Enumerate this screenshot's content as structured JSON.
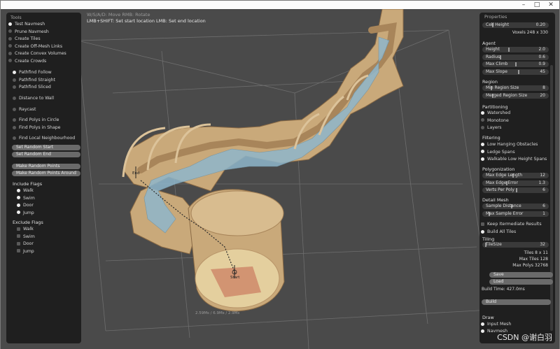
{
  "hud": {
    "help_line1": "W/S/A/D: Move  RMB: Rotate",
    "help_line2": "LMB+SHIFT: Set start location  LMB: Set end location",
    "start_label": "Start",
    "end_label": "End",
    "bottom_stats": "2.59Ms / 6.9Ms / 2.9Ms"
  },
  "tools": {
    "title": "Tools",
    "tool_options": [
      {
        "label": "Test Navmesh",
        "on": true
      },
      {
        "label": "Prune Navmesh",
        "on": false
      },
      {
        "label": "Create Tiles",
        "on": false
      },
      {
        "label": "Create Off-Mesh Links",
        "on": false
      },
      {
        "label": "Create Convex Volumes",
        "on": false
      },
      {
        "label": "Create Crowds",
        "on": false
      }
    ],
    "modes": [
      {
        "label": "Pathfind Follow",
        "on": true
      },
      {
        "label": "Pathfind Straight",
        "on": false
      },
      {
        "label": "Pathfind Sliced",
        "on": false
      },
      {
        "label": "Distance to Wall",
        "on": false
      },
      {
        "label": "Raycast",
        "on": false
      },
      {
        "label": "Find Polys in Circle",
        "on": false
      },
      {
        "label": "Find Polys in Shape",
        "on": false
      },
      {
        "label": "Find Local Neighbourhood",
        "on": false
      }
    ],
    "buttons": [
      "Set Random Start",
      "Set Random End",
      "Make Random Points",
      "Make Random Points Around"
    ],
    "include_title": "Include Flags",
    "include": [
      {
        "label": "Walk",
        "on": true
      },
      {
        "label": "Swim",
        "on": true
      },
      {
        "label": "Door",
        "on": true
      },
      {
        "label": "Jump",
        "on": true
      }
    ],
    "exclude_title": "Exclude Flags",
    "exclude": [
      {
        "label": "Walk",
        "on": false
      },
      {
        "label": "Swim",
        "on": false
      },
      {
        "label": "Door",
        "on": false
      },
      {
        "label": "Jump",
        "on": false
      }
    ]
  },
  "props": {
    "title": "Properties",
    "cell_height": {
      "label": "Cell Height",
      "value": "0.20"
    },
    "voxels": "Voxels  248 x 330",
    "agent_title": "Agent",
    "agent": [
      {
        "label": "Height",
        "value": "2.0"
      },
      {
        "label": "Radius",
        "value": "0.6"
      },
      {
        "label": "Max Climb",
        "value": "0.9"
      },
      {
        "label": "Max Slope",
        "value": "45"
      }
    ],
    "region_title": "Region",
    "region": [
      {
        "label": "Min Region Size",
        "value": "8"
      },
      {
        "label": "Merged Region Size",
        "value": "20"
      }
    ],
    "partition_title": "Partitioning",
    "partition": [
      {
        "label": "Watershed",
        "on": true
      },
      {
        "label": "Monotone",
        "on": false
      },
      {
        "label": "Layers",
        "on": false
      }
    ],
    "filter_title": "Filtering",
    "filter": [
      {
        "label": "Low Hanging Obstacles",
        "on": true
      },
      {
        "label": "Ledge Spans",
        "on": true
      },
      {
        "label": "Walkable Low Height Spans",
        "on": true
      }
    ],
    "poly_title": "Polygonization",
    "poly": [
      {
        "label": "Max Edge Length",
        "value": "12"
      },
      {
        "label": "Max Edge Error",
        "value": "1.3"
      },
      {
        "label": "Verts Per Poly",
        "value": "6"
      }
    ],
    "detail_title": "Detail Mesh",
    "detail": [
      {
        "label": "Sample Distance",
        "value": "6"
      },
      {
        "label": "Max Sample Error",
        "value": "1"
      }
    ],
    "keep_intermediate": "Keep Itermediate Results",
    "build_all_tiles": "Build All Tiles",
    "tiling_title": "Tiling",
    "tile_size": {
      "label": "TileSize",
      "value": "32"
    },
    "tiles": "Tiles  8 x 11",
    "max_tiles": "Max Tiles  128",
    "max_polys": "Max Polys  32768",
    "save": "Save",
    "load": "Load",
    "build_time": "Build Time: 427.0ms",
    "build": "Build",
    "draw_title": "Draw",
    "draw_input_mesh": "Input Mesh",
    "draw_navmesh": "Navmesh"
  },
  "watermark": "CSDN @谢白羽",
  "colors": {
    "panel_bg": "#1f1f1f",
    "viewport_bg": "#4a4a4a",
    "wall": "#c9a97a",
    "navmesh": "#8fb7cc",
    "start_area": "#cf8a6a"
  }
}
